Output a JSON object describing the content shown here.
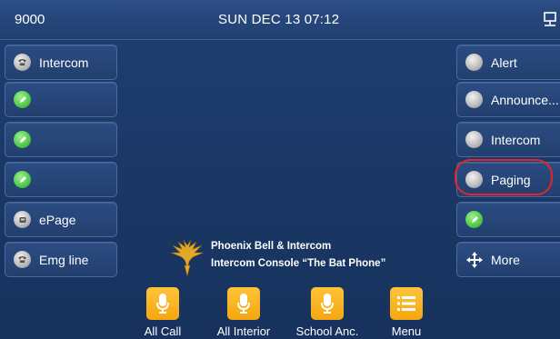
{
  "status_bar": {
    "extension": "9000",
    "datetime": "SUN DEC 13  07:12",
    "network_icon": "network-icon"
  },
  "left_keys": [
    {
      "label": "Intercom",
      "icon": "phone-icon",
      "color": "grey"
    },
    {
      "label": "",
      "icon": "green-line-icon",
      "color": "green"
    },
    {
      "label": "",
      "icon": "green-line-icon",
      "color": "green"
    },
    {
      "label": "",
      "icon": "green-line-icon",
      "color": "green"
    },
    {
      "label": "ePage",
      "icon": "page-icon",
      "color": "grey"
    },
    {
      "label": "Emg line",
      "icon": "phone-icon",
      "color": "grey"
    }
  ],
  "right_keys": [
    {
      "label": "Alert",
      "icon": "grey-line-icon",
      "color": "grey"
    },
    {
      "label": "Announce...",
      "icon": "grey-line-icon",
      "color": "grey"
    },
    {
      "label": "Intercom",
      "icon": "grey-line-icon",
      "color": "grey"
    },
    {
      "label": "Paging",
      "icon": "grey-line-icon",
      "color": "grey"
    },
    {
      "label": "",
      "icon": "green-line-icon",
      "color": "green"
    },
    {
      "label": "More",
      "icon": "move-arrows-icon",
      "color": "none"
    }
  ],
  "brand": {
    "line1": "Phoenix Bell & Intercom",
    "line2": "Intercom Console “The Bat Phone”"
  },
  "softkeys": [
    {
      "label": "All Call",
      "icon": "microphone-icon"
    },
    {
      "label": "All Interior",
      "icon": "microphone-icon"
    },
    {
      "label": "School Anc.",
      "icon": "microphone-icon"
    },
    {
      "label": "Menu",
      "icon": "menu-list-icon"
    }
  ],
  "colors": {
    "background": "#1a3765",
    "key_border": "#4a6aa0",
    "softkey": "#f5a60f",
    "callout": "#e1262c"
  }
}
